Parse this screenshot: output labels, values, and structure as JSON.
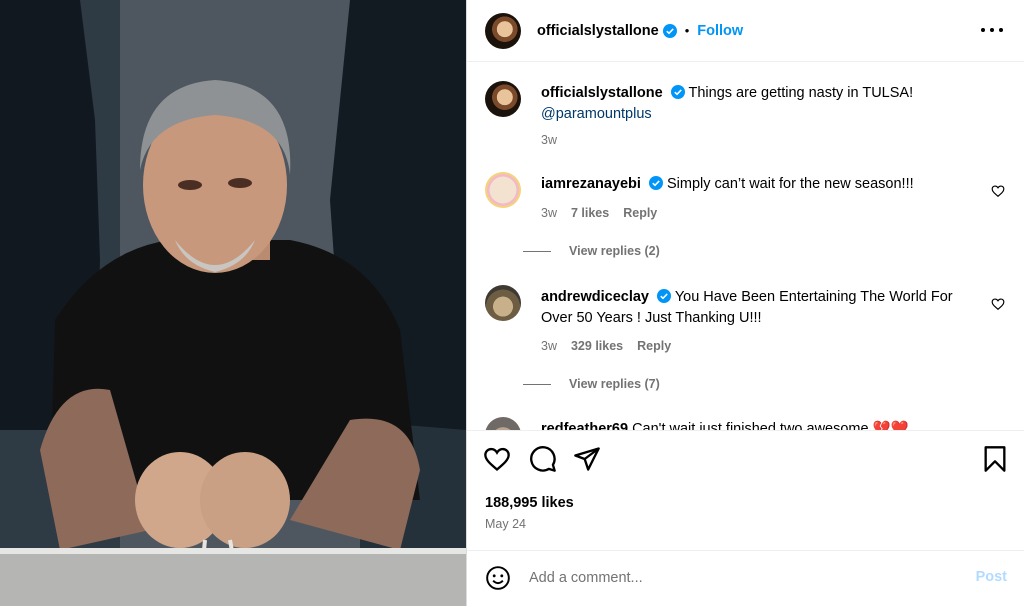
{
  "post": {
    "author": "officialslystallone",
    "follow_label": "Follow",
    "dot": "•",
    "caption_text": "Things are getting nasty in TULSA!",
    "caption_mention": "@paramountplus",
    "caption_age": "3w"
  },
  "comments": [
    {
      "user": "iamrezanayebi",
      "text": "Simply can’t wait for the new season!!!",
      "age": "3w",
      "likes": "7 likes",
      "reply_label": "Reply",
      "view_replies": "View replies (2)"
    },
    {
      "user": "andrewdiceclay",
      "text": "You Have Been Entertaining The World For Over 50 Years ! Just Thanking U!!!",
      "age": "3w",
      "likes": "329 likes",
      "reply_label": "Reply",
      "view_replies": "View replies (7)"
    },
    {
      "user": "redfeather69",
      "text": "Can't wait just finished two awesome 💔❤️"
    }
  ],
  "engagement": {
    "likes": "188,995 likes",
    "date": "May 24"
  },
  "composer": {
    "placeholder": "Add a comment...",
    "post_label": "Post"
  },
  "icons": {
    "verified": "verified-badge-icon",
    "more": "more-options-icon",
    "heart": "heart-icon",
    "comment": "comment-icon",
    "share": "share-icon",
    "save": "bookmark-icon",
    "emoji": "emoji-icon"
  },
  "colors": {
    "accent": "#0095f6",
    "mention": "#00376b",
    "muted": "#737373",
    "post_disabled": "#b3dbff"
  }
}
